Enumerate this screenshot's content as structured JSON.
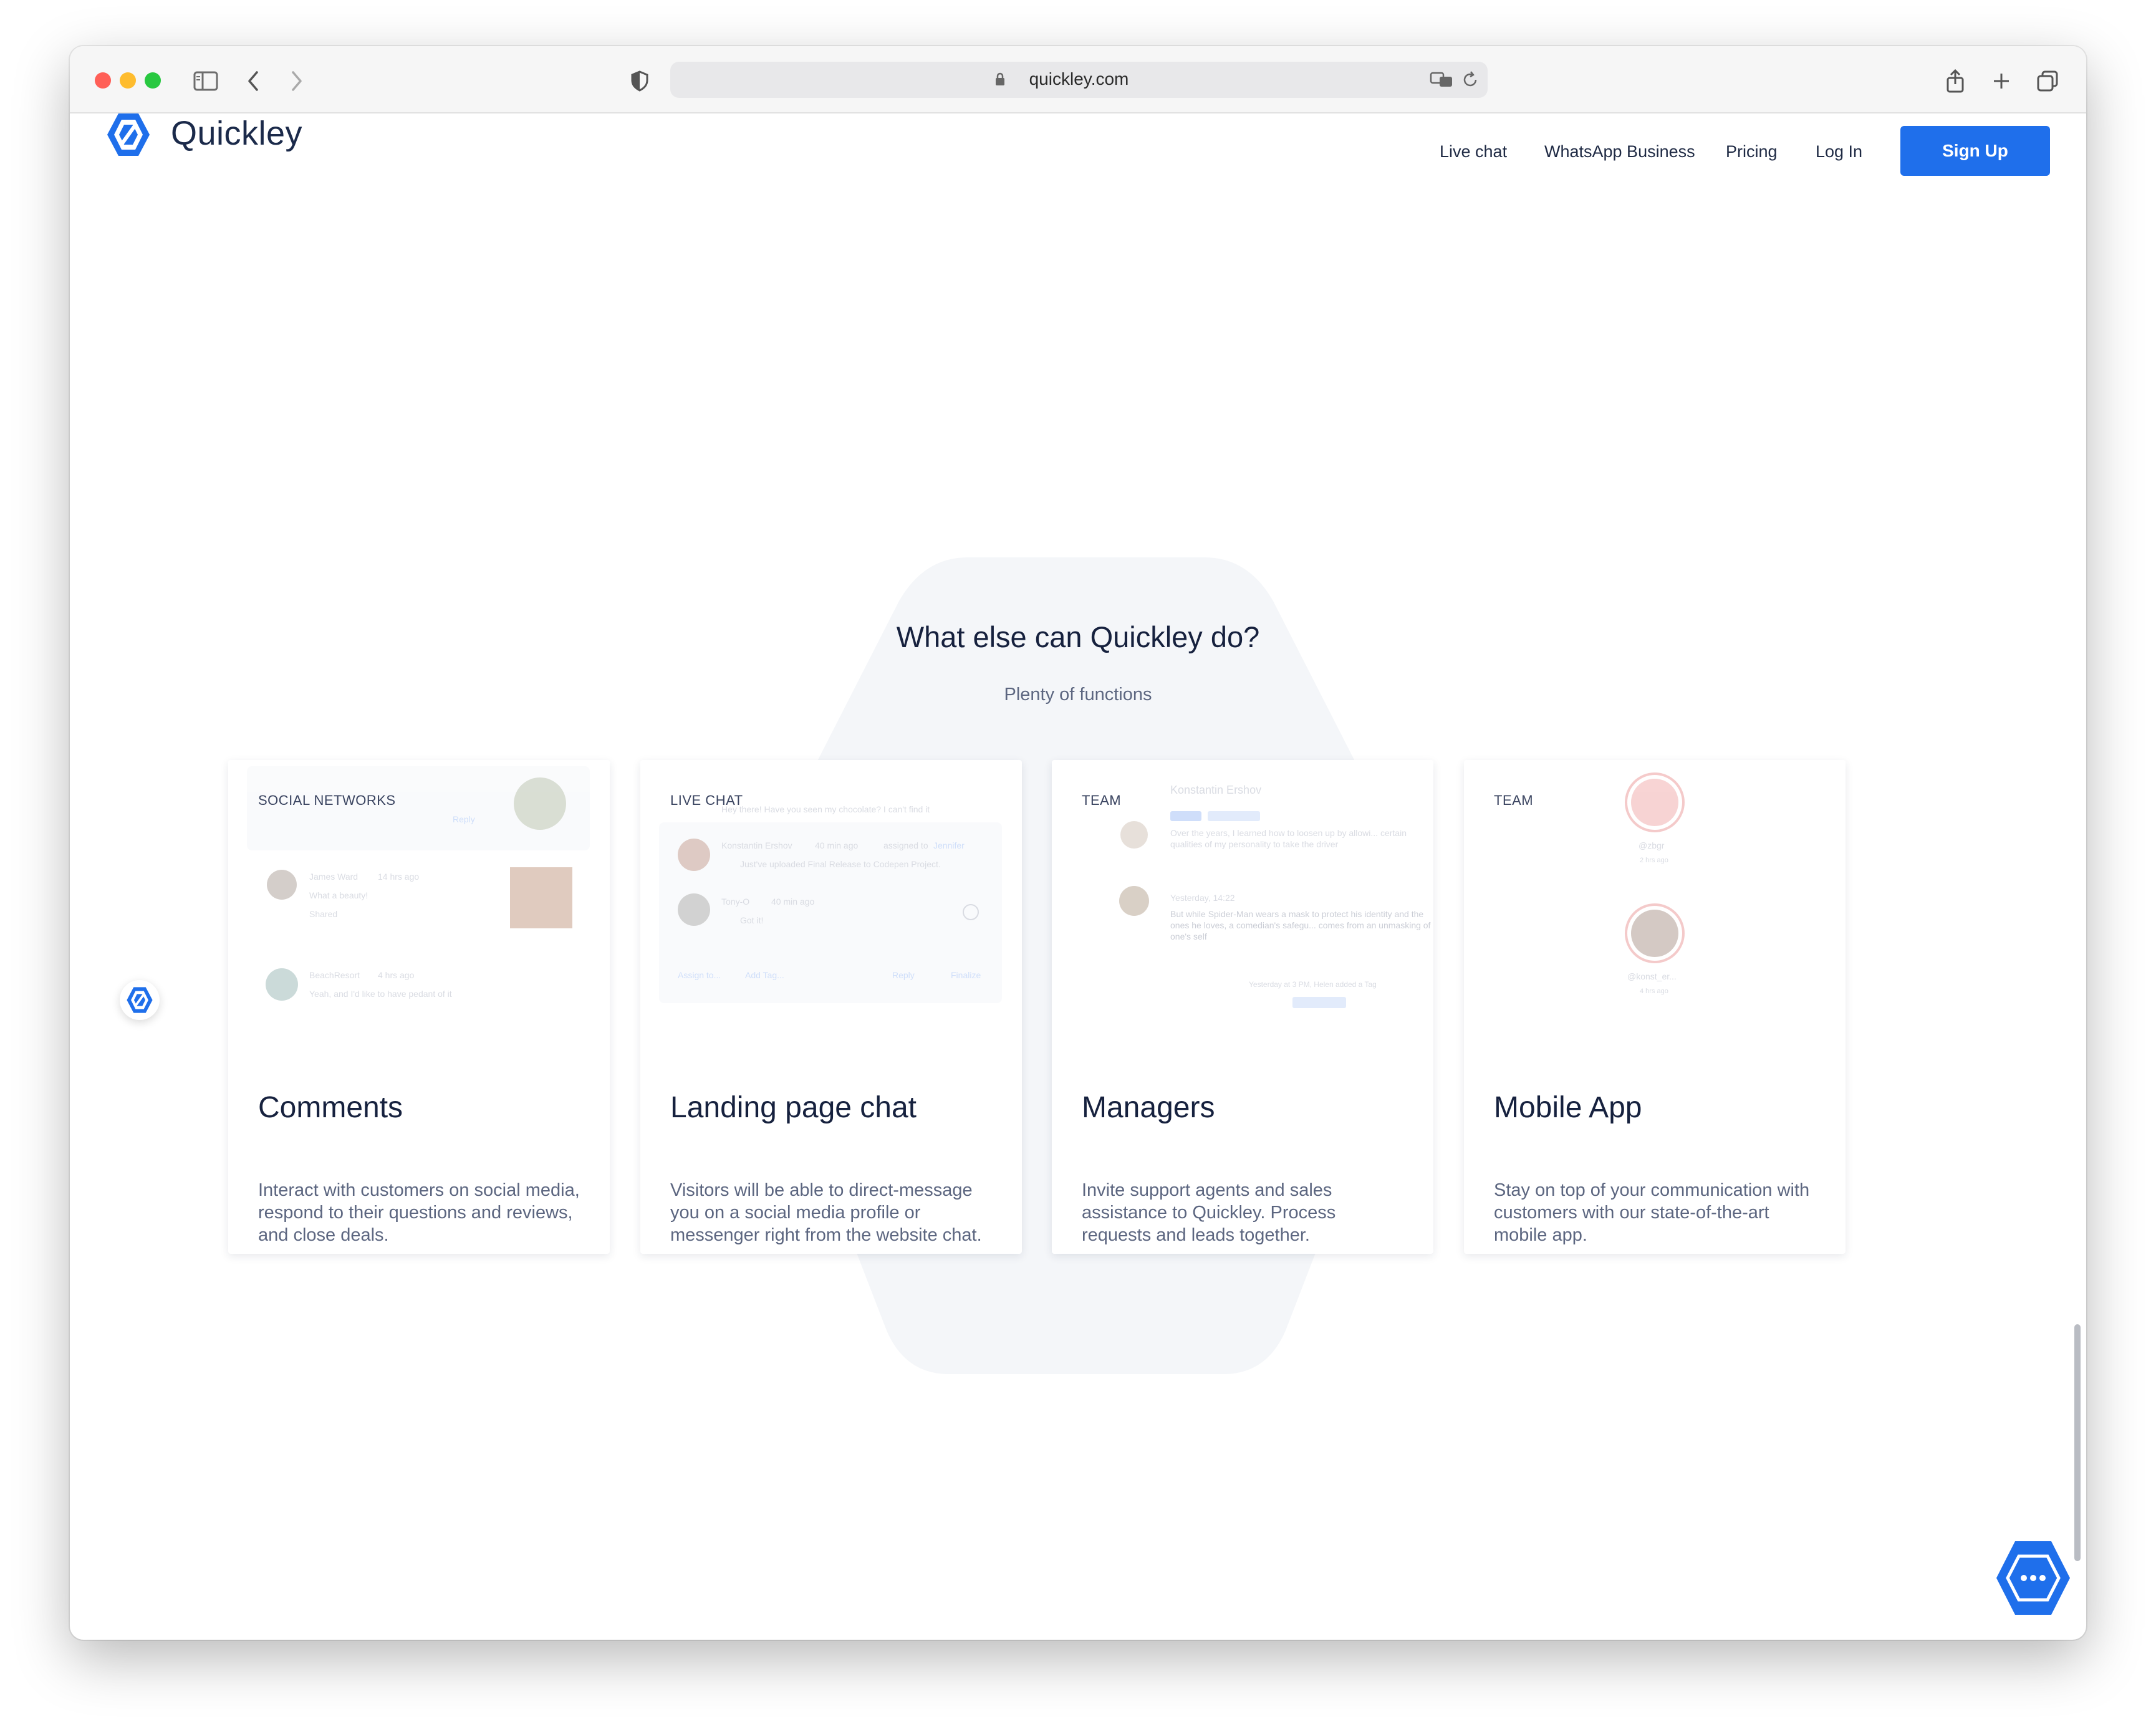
{
  "browser": {
    "url": "quickley.com"
  },
  "site": {
    "brand": "Quickley",
    "nav": {
      "links": [
        "Live chat",
        "WhatsApp Business",
        "Pricing",
        "Log In"
      ],
      "signup": "Sign Up"
    }
  },
  "section": {
    "title": "What else can Quickley do?",
    "subtitle": "Plenty of functions",
    "cards": [
      {
        "tag": "SOCIAL NETWORKS",
        "title": "Comments",
        "description": "Interact with customers on social media, respond to their questions and reviews, and close deals.",
        "preview": {
          "name1": "James Ward",
          "time1": "14 hrs ago",
          "msg1": "What a beauty!",
          "action1": "Shared",
          "reply": "Reply",
          "name2": "BeachResort",
          "time2": "4 hrs ago",
          "msg2": "Yeah, and I'd like to have pedant of it"
        }
      },
      {
        "tag": "LIVE CHAT",
        "title": "Landing page chat",
        "description": "Visitors will be able to direct-message you on a social media profile or messenger right from the website chat.",
        "preview": {
          "top_msg": "Hey there! Have you seen my chocolate? I can't find it",
          "name1": "Konstantin Ershov",
          "time1": "40 min ago",
          "assigned": "assigned to",
          "assignee": "Jennifer",
          "msg1": "Just've uploaded Final Release to Codepen Project.",
          "name2": "Tony-O",
          "time2": "40 min ago",
          "msg2": "Got it!",
          "actions": [
            "Assign to...",
            "Add Tag...",
            "Reply",
            "Finalize"
          ]
        }
      },
      {
        "tag": "TEAM",
        "title": "Managers",
        "description": "Invite support agents and sales assistance to Quickley. Process requests and leads together.",
        "preview": {
          "name": "Konstantin Ershov",
          "msg1": "Over the years, I learned how to loosen up by allowi... certain qualities of my personality to take the driver",
          "date": "Yesterday, 14:22",
          "msg2": "But while Spider-Man wears a mask to protect his identity and the ones he loves, a comedian's safegu... comes from an unmasking of one's self",
          "footer": "Yesterday at 3 PM, Helen added a Tag"
        }
      },
      {
        "tag": "TEAM",
        "title": "Mobile App",
        "description": "Stay on top of your communication with customers with our state-of-the-art mobile app.",
        "preview": {
          "user1": "@zbgr",
          "time1": "2 hrs ago",
          "user2": "@konst_er...",
          "time2": "4 hrs ago"
        }
      }
    ]
  },
  "colors": {
    "accent": "#1f6feb",
    "title": "#16213e",
    "muted": "#5c6680",
    "hex_bg": "#f4f6f9"
  }
}
